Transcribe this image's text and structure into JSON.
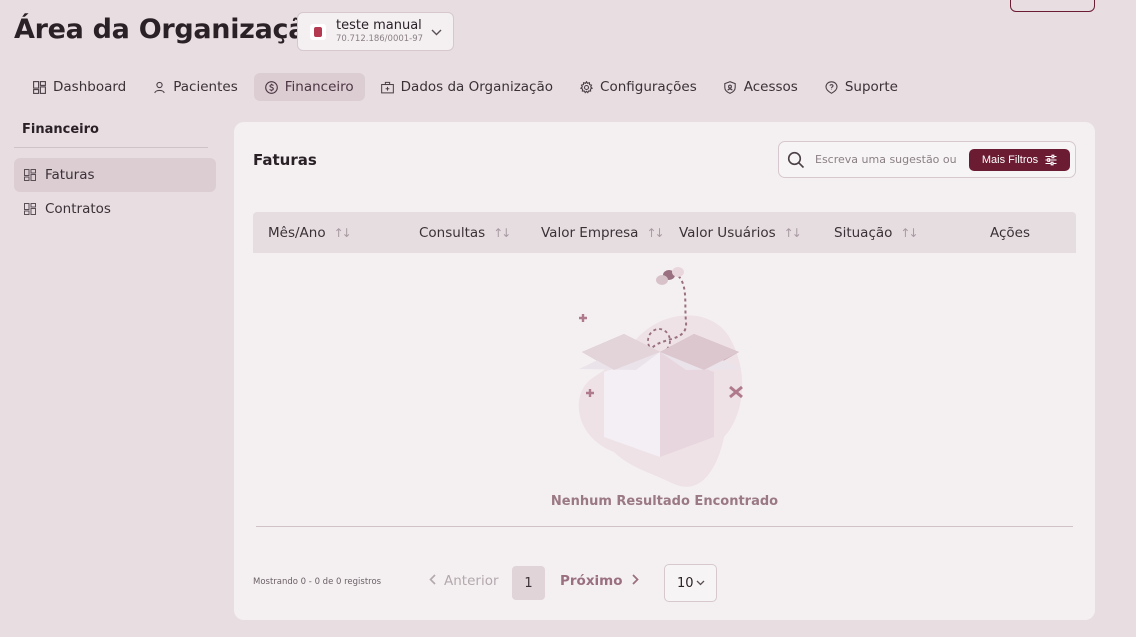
{
  "header": {
    "title": "Área da Organização",
    "org": {
      "name": "teste manual",
      "cnpj": "70.712.186/0001-97"
    }
  },
  "tabs": [
    {
      "label": "Dashboard",
      "icon": "dashboard-icon",
      "active": false
    },
    {
      "label": "Pacientes",
      "icon": "user-icon",
      "active": false
    },
    {
      "label": "Financeiro",
      "icon": "dollar-circle-icon",
      "active": true
    },
    {
      "label": "Dados da Organização",
      "icon": "briefcase-icon",
      "active": false
    },
    {
      "label": "Configurações",
      "icon": "gear-icon",
      "active": false
    },
    {
      "label": "Acessos",
      "icon": "shield-icon",
      "active": false
    },
    {
      "label": "Suporte",
      "icon": "help-icon",
      "active": false
    }
  ],
  "sidebar": {
    "title": "Financeiro",
    "items": [
      {
        "label": "Faturas",
        "active": true
      },
      {
        "label": "Contratos",
        "active": false
      }
    ]
  },
  "main": {
    "title": "Faturas",
    "search_placeholder": "Escreva uma sugestão ou p",
    "filters_label": "Mais Filtros",
    "columns": [
      "Mês/Ano",
      "Consultas",
      "Valor Empresa",
      "Valor Usuários",
      "Situação",
      "Ações"
    ],
    "empty_text": "Nenhum Resultado Encontrado",
    "pagination": {
      "showing": "Mostrando 0 - 0 de 0 registros",
      "prev_label": "Anterior",
      "current_page": "1",
      "next_label": "Próximo",
      "page_size": "10"
    }
  },
  "colors": {
    "accent": "#6b1c33",
    "background": "#e8dee2",
    "panel": "#f4f0f2"
  }
}
